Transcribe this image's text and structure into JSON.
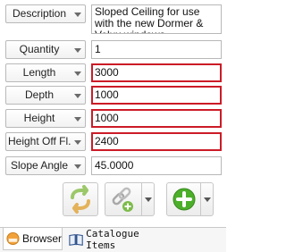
{
  "properties": [
    {
      "label": "Description",
      "value": "Sloped Ceiling for use with the new Dormer & Velux windows",
      "highlighted": false
    },
    {
      "label": "Quantity",
      "value": "1",
      "highlighted": false
    },
    {
      "label": "Length",
      "value": "3000",
      "highlighted": true
    },
    {
      "label": "Depth",
      "value": "1000",
      "highlighted": true
    },
    {
      "label": "Height",
      "value": "1000",
      "highlighted": true
    },
    {
      "label": "Height Off Fl...",
      "value": "2400",
      "highlighted": true
    },
    {
      "label": "Slope Angle",
      "value": "45.0000",
      "highlighted": false
    }
  ],
  "toolbar": {
    "refresh_icon": "refresh-arrows-icon",
    "link_icon": "chain-link-add-icon",
    "add_icon": "green-plus-circle-icon"
  },
  "tabs": [
    {
      "label": "Browser",
      "icon": "browser-icon",
      "active": true
    },
    {
      "label": "Catalogue Items",
      "icon": "book-icon",
      "active": false
    }
  ],
  "colors": {
    "highlight_border": "#cc1b27",
    "add_green": "#4caf2a"
  }
}
